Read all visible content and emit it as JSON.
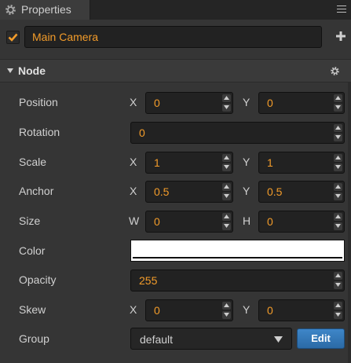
{
  "tab": {
    "title": "Properties",
    "icon": "gear-icon"
  },
  "node_header": {
    "enabled": true,
    "name": "Main Camera"
  },
  "section": {
    "title": "Node",
    "expanded": true
  },
  "colors": {
    "accent": "#f39c2a",
    "edit_button": "#3478b8",
    "color_value": "#ffffff"
  },
  "props": {
    "position": {
      "label": "Position",
      "x_label": "X",
      "x": "0",
      "y_label": "Y",
      "y": "0"
    },
    "rotation": {
      "label": "Rotation",
      "value": "0"
    },
    "scale": {
      "label": "Scale",
      "x_label": "X",
      "x": "1",
      "y_label": "Y",
      "y": "1"
    },
    "anchor": {
      "label": "Anchor",
      "x_label": "X",
      "x": "0.5",
      "y_label": "Y",
      "y": "0.5"
    },
    "size": {
      "label": "Size",
      "w_label": "W",
      "w": "0",
      "h_label": "H",
      "h": "0"
    },
    "color": {
      "label": "Color"
    },
    "opacity": {
      "label": "Opacity",
      "value": "255"
    },
    "skew": {
      "label": "Skew",
      "x_label": "X",
      "x": "0",
      "y_label": "Y",
      "y": "0"
    },
    "group": {
      "label": "Group",
      "value": "default",
      "edit_label": "Edit"
    }
  }
}
